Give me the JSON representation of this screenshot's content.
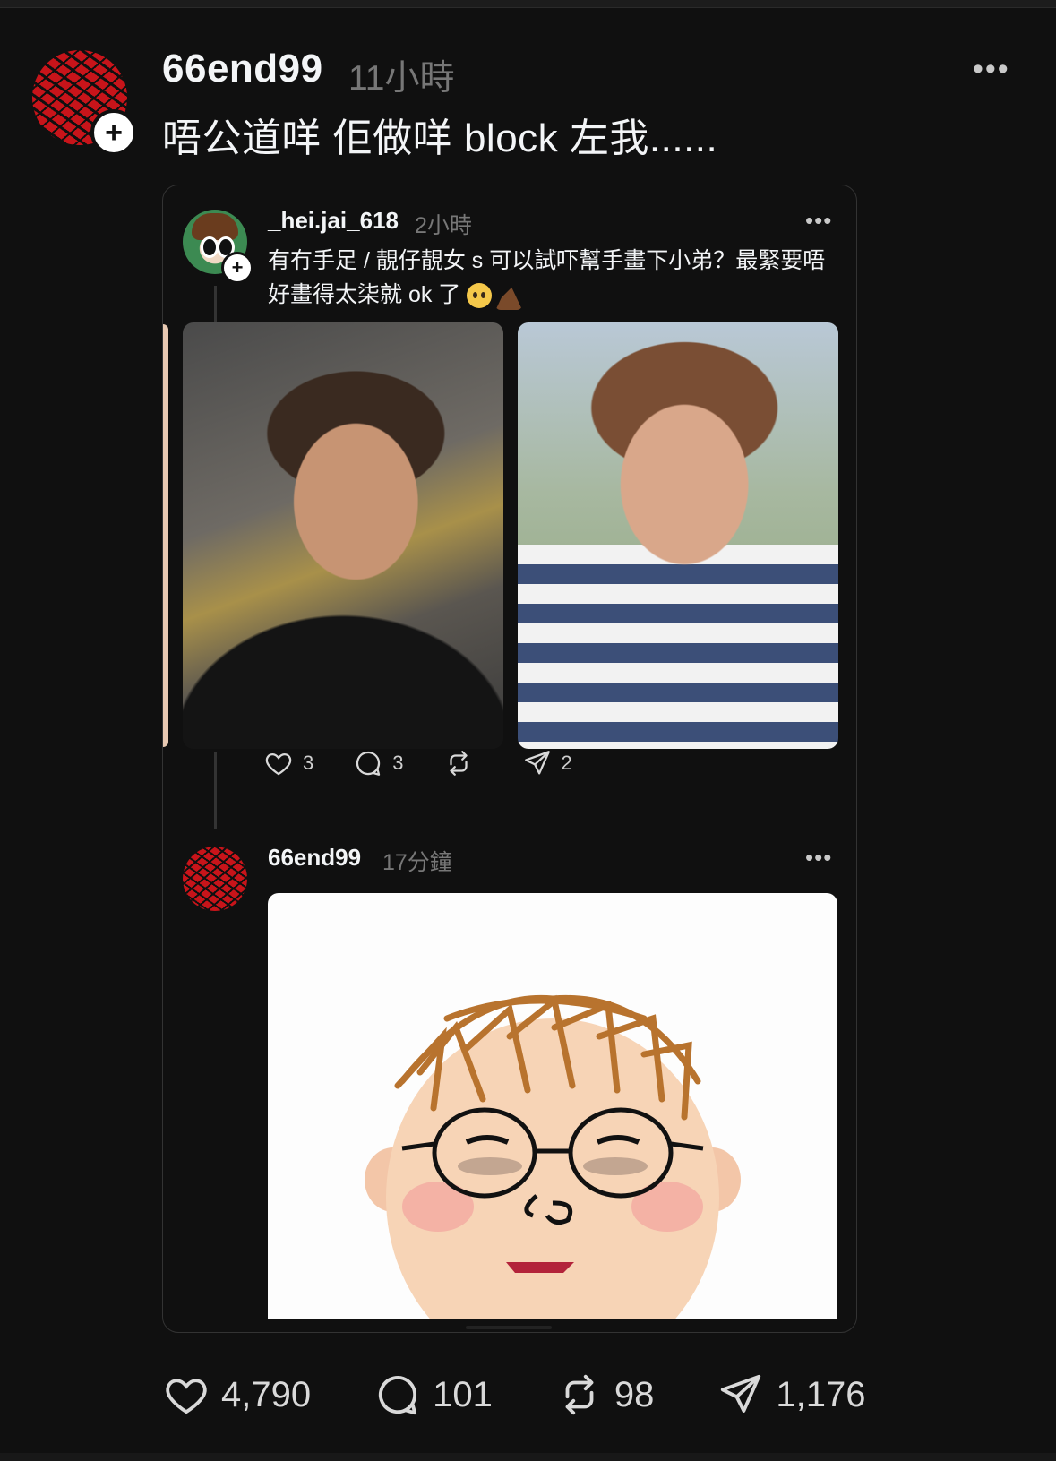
{
  "post": {
    "username": "66end99",
    "time": "11小時",
    "text": "唔公道咩 佢做咩 block 左我......",
    "more": "•••"
  },
  "quoted": {
    "username": "_hei.jai_618",
    "time": "2小時",
    "text": "有冇手足 / 靚仔靚女 s 可以試吓幫手畫下小弟？最緊要唔好畫得太柒就 ok 了",
    "more": "•••",
    "likes": "3",
    "comments": "3",
    "shares": "2"
  },
  "reply": {
    "username": "66end99",
    "time": "17分鐘",
    "more": "•••"
  },
  "stats": {
    "likes": "4,790",
    "comments": "101",
    "reposts": "98",
    "shares": "1,176"
  },
  "colors": {
    "background": "#101010",
    "text": "#f3f5f7",
    "muted": "#777777",
    "avatar_red": "#c8141a"
  },
  "icons": [
    "plus-icon",
    "more-icon",
    "heart-icon",
    "comment-icon",
    "repost-icon",
    "share-icon"
  ]
}
